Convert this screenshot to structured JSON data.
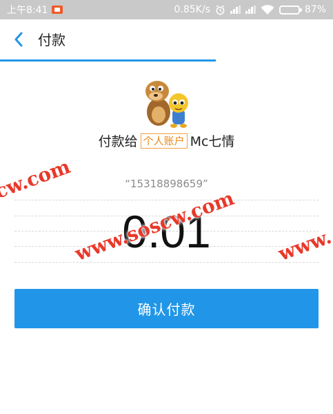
{
  "status_bar": {
    "time": "上午8:41",
    "network_speed": "0.85K/s",
    "battery_level": "87%",
    "battery_fraction": 0.87,
    "icons": [
      "recording-icon",
      "alarm-icon",
      "signal-icon",
      "signal-icon",
      "wifi-icon",
      "battery-icon"
    ]
  },
  "header": {
    "back_icon": "chevron-left-icon",
    "title": "付款",
    "accent_color": "#2196e8"
  },
  "payee": {
    "prefix": "付款给",
    "tag": "个人账户",
    "name": "Mc七情",
    "account": "“15318898659”"
  },
  "amount": {
    "value": "0.01"
  },
  "actions": {
    "confirm_label": "确认付款"
  },
  "watermarks": [
    "cw.com",
    "www.soscw.com",
    "www."
  ]
}
